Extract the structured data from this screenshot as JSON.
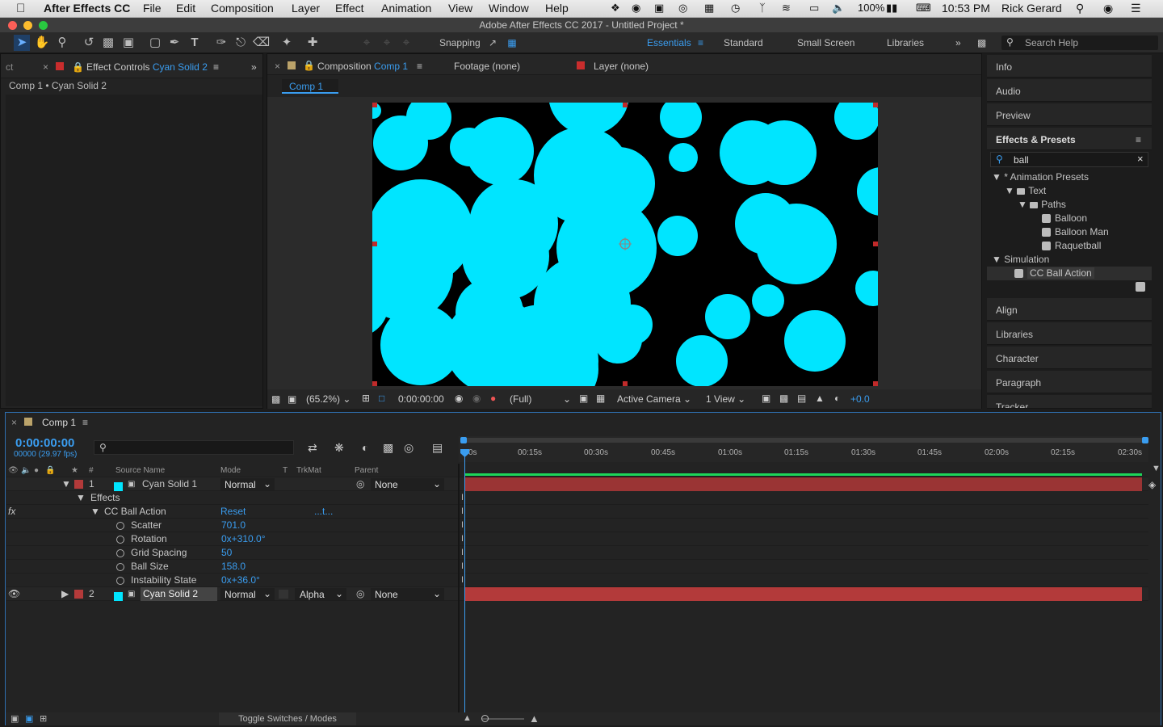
{
  "menubar": {
    "app": "After Effects CC",
    "items": [
      "File",
      "Edit",
      "Composition",
      "Layer",
      "Effect",
      "Animation",
      "View",
      "Window",
      "Help"
    ],
    "battery": "100%",
    "clock": "10:53 PM",
    "user": "Rick Gerard"
  },
  "window": {
    "title": "Adobe After Effects CC 2017 - Untitled Project *"
  },
  "toolbar": {
    "snapping": "Snapping",
    "workspaces": [
      "Essentials",
      "Standard",
      "Small Screen",
      "Libraries"
    ],
    "search_placeholder": "Search Help"
  },
  "effect_controls": {
    "left_stub": "ct",
    "tab_prefix": "Effect Controls",
    "tab_layer": "Cyan Solid 2",
    "breadcrumb": "Comp 1 • Cyan Solid 2"
  },
  "composition": {
    "tab_prefix": "Composition",
    "tab_name": "Comp 1",
    "footage_tab": "Footage (none)",
    "layer_tab": "Layer (none)",
    "subtab": "Comp 1",
    "zoom": "(65.2%)",
    "timecode": "0:00:00:00",
    "resolution": "(Full)",
    "camera": "Active Camera",
    "views": "1 View",
    "exposure": "+0.0"
  },
  "right_panels": {
    "info": "Info",
    "audio": "Audio",
    "preview": "Preview",
    "effects_presets": "Effects & Presets",
    "search_value": "ball",
    "tree": [
      {
        "label": "* Animation Presets",
        "level": 0,
        "kind": "root"
      },
      {
        "label": "Text",
        "level": 1,
        "kind": "folder"
      },
      {
        "label": "Paths",
        "level": 2,
        "kind": "folder"
      },
      {
        "label": "Balloon",
        "level": 3,
        "kind": "preset"
      },
      {
        "label": "Balloon Man",
        "level": 3,
        "kind": "preset"
      },
      {
        "label": "Raquetball",
        "level": 3,
        "kind": "preset"
      },
      {
        "label": "Simulation",
        "level": 0,
        "kind": "root"
      },
      {
        "label": "CC Ball Action",
        "level": 2,
        "kind": "effect"
      }
    ],
    "lower": [
      "Align",
      "Libraries",
      "Character",
      "Paragraph",
      "Tracker"
    ]
  },
  "timeline": {
    "tab": "Comp 1",
    "timecode": "0:00:00:00",
    "frames": "00000 (29.97 fps)",
    "headers": {
      "num": "#",
      "source": "Source Name",
      "mode": "Mode",
      "t": "T",
      "trkmat": "TrkMat",
      "parent": "Parent"
    },
    "ticks": [
      "0s",
      "00:15s",
      "00:30s",
      "00:45s",
      "01:00s",
      "01:15s",
      "01:30s",
      "01:45s",
      "02:00s",
      "02:15s",
      "02:30s"
    ],
    "layer1": {
      "num": "1",
      "name": "Cyan Solid 1",
      "mode": "Normal",
      "parent": "None"
    },
    "effects_label": "Effects",
    "effect": {
      "name": "CC Ball Action",
      "reset": "Reset",
      "extra": "...t..."
    },
    "props": [
      {
        "name": "Scatter",
        "value": "701.0"
      },
      {
        "name": "Rotation",
        "value": "0x+310.0°"
      },
      {
        "name": "Grid Spacing",
        "value": "50"
      },
      {
        "name": "Ball Size",
        "value": "158.0"
      },
      {
        "name": "Instability State",
        "value": "0x+36.0°"
      }
    ],
    "layer2": {
      "num": "2",
      "name": "Cyan Solid 2",
      "mode": "Normal",
      "trkmat": "Alpha",
      "parent": "None"
    },
    "footer": "Toggle Switches / Modes"
  },
  "colors": {
    "accent": "#3a9df0",
    "cyan": "#00e5ff",
    "layer_red": "#b33a3a",
    "label_red": "#c92d2d"
  }
}
